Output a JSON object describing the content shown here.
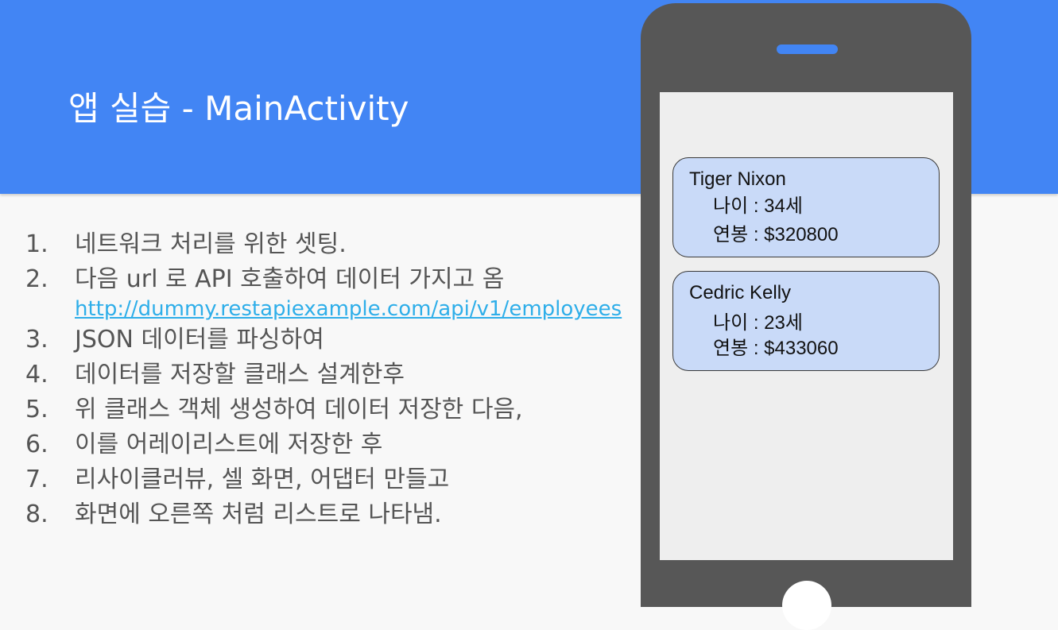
{
  "slide": {
    "title": "앱 실습 - MainActivity",
    "steps": [
      {
        "num": "1.",
        "text": "네트워크 처리를 위한 셋팅."
      },
      {
        "num": "2.",
        "text": "다음 url 로 API 호출하여 데이터 가지고 옴",
        "link": "http://dummy.restapiexample.com/api/v1/employees"
      },
      {
        "num": "3.",
        "text": "JSON 데이터를 파싱하여"
      },
      {
        "num": "4.",
        "text": "데이터를 저장할 클래스 설계한후"
      },
      {
        "num": "5.",
        "text": "위 클래스 객체 생성하여 데이터 저장한 다음,"
      },
      {
        "num": "6.",
        "text": "이를 어레이리스트에 저장한 후"
      },
      {
        "num": "7.",
        "text": "리사이클러뷰, 셀 화면, 어댑터 만들고"
      },
      {
        "num": "8.",
        "text": "화면에 오른쪽 처럼 리스트로 나타냄."
      }
    ]
  },
  "phone": {
    "cards": [
      {
        "name": "Tiger Nixon",
        "age": "나이 : 34세",
        "salary": "연봉 : $320800"
      },
      {
        "name": "Cedric Kelly",
        "age": "나이 : 23세",
        "salary": "연봉 : $433060"
      }
    ]
  },
  "colors": {
    "header": "#4285f4",
    "card": "#c9daf8",
    "phone_body": "#575757",
    "link": "#2eaee9"
  }
}
